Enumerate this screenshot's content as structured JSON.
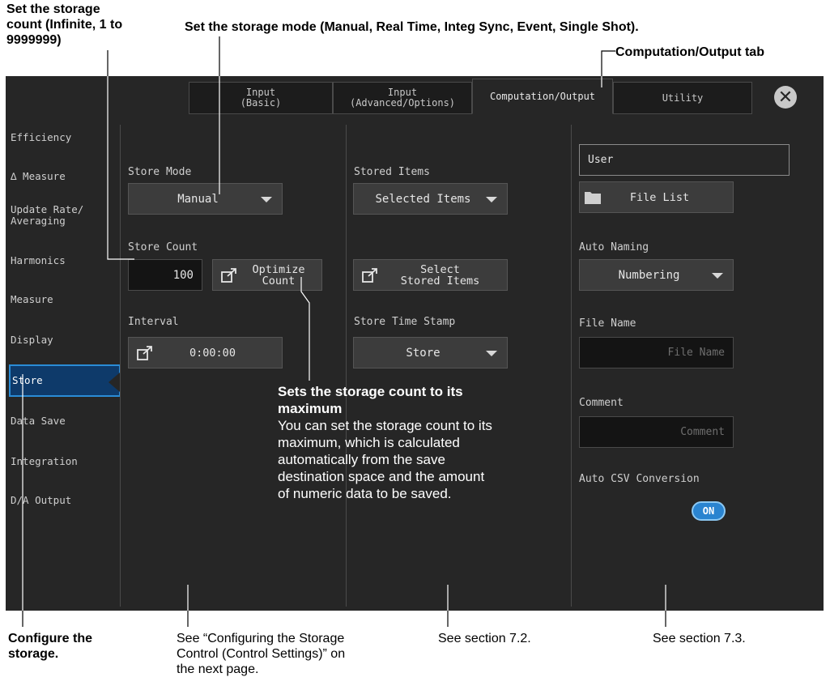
{
  "annotations": {
    "storage_count_l1": "Set the storage",
    "storage_count_l2": "count (Infinite, 1 to",
    "storage_count_l3": "9999999)",
    "storage_mode": "Set the storage mode (Manual, Real Time, Integ Sync, Event, Single Shot).",
    "comp_tab": "Computation/Output tab",
    "optimize_heading_l1": "Sets the storage count to its",
    "optimize_heading_l2": "maximum",
    "optimize_body_l1": "You can set the storage count to its",
    "optimize_body_l2": "maximum, which is calculated",
    "optimize_body_l3": "automatically from the save",
    "optimize_body_l4": "destination space and the amount",
    "optimize_body_l5": "of numeric data to be saved.",
    "configure_l1": "Configure the",
    "configure_l2": "storage.",
    "see_control_l1": "See “Configuring the Storage",
    "see_control_l2": "Control (Control Settings)” on",
    "see_control_l3": "the next page.",
    "see_72": "See section 7.2.",
    "see_73": "See section 7.3."
  },
  "tabs": [
    {
      "line1": "Input",
      "line2": "(Basic)"
    },
    {
      "line1": "Input",
      "line2": "(Advanced/Options)"
    },
    {
      "line1": "Computation/Output",
      "line2": ""
    },
    {
      "line1": "Utility",
      "line2": ""
    }
  ],
  "close_icon": "close-icon",
  "sidebar": {
    "items": [
      {
        "l1": "Efficiency",
        "l2": ""
      },
      {
        "l1": "∆ Measure",
        "l2": ""
      },
      {
        "l1": "Update Rate/",
        "l2": "Averaging"
      },
      {
        "l1": "Harmonics",
        "l2": ""
      },
      {
        "l1": "Measure",
        "l2": ""
      },
      {
        "l1": "Display",
        "l2": ""
      },
      {
        "l1": "Store",
        "l2": ""
      },
      {
        "l1": "Data Save",
        "l2": ""
      },
      {
        "l1": "Integration",
        "l2": ""
      },
      {
        "l1": "D/A Output",
        "l2": ""
      }
    ],
    "selected": "Store"
  },
  "store": {
    "mode_label": "Store Mode",
    "mode_value": "Manual",
    "count_label": "Store Count",
    "count_value": "100",
    "optimize_l1": "Optimize",
    "optimize_l2": "Count",
    "interval_label": "Interval",
    "interval_value": "0:00:00"
  },
  "items": {
    "stored_items_label": "Stored Items",
    "stored_items_value": "Selected Items",
    "select_l1": "Select",
    "select_l2": "Stored Items",
    "timestamp_label": "Store Time Stamp",
    "timestamp_value": "Store"
  },
  "file": {
    "path_value": "User",
    "file_list_label": "File List",
    "auto_naming_label": "Auto Naming",
    "auto_naming_value": "Numbering",
    "file_name_label": "File Name",
    "file_name_placeholder": "File Name",
    "comment_label": "Comment",
    "comment_placeholder": "Comment",
    "csv_label": "Auto CSV Conversion",
    "csv_toggle": "ON"
  },
  "colors": {
    "screen_bg": "#262626",
    "active_sidebar_bg": "#0e3a6a",
    "active_sidebar_border": "#2a8cd6",
    "toggle_on": "#2a84d0"
  }
}
